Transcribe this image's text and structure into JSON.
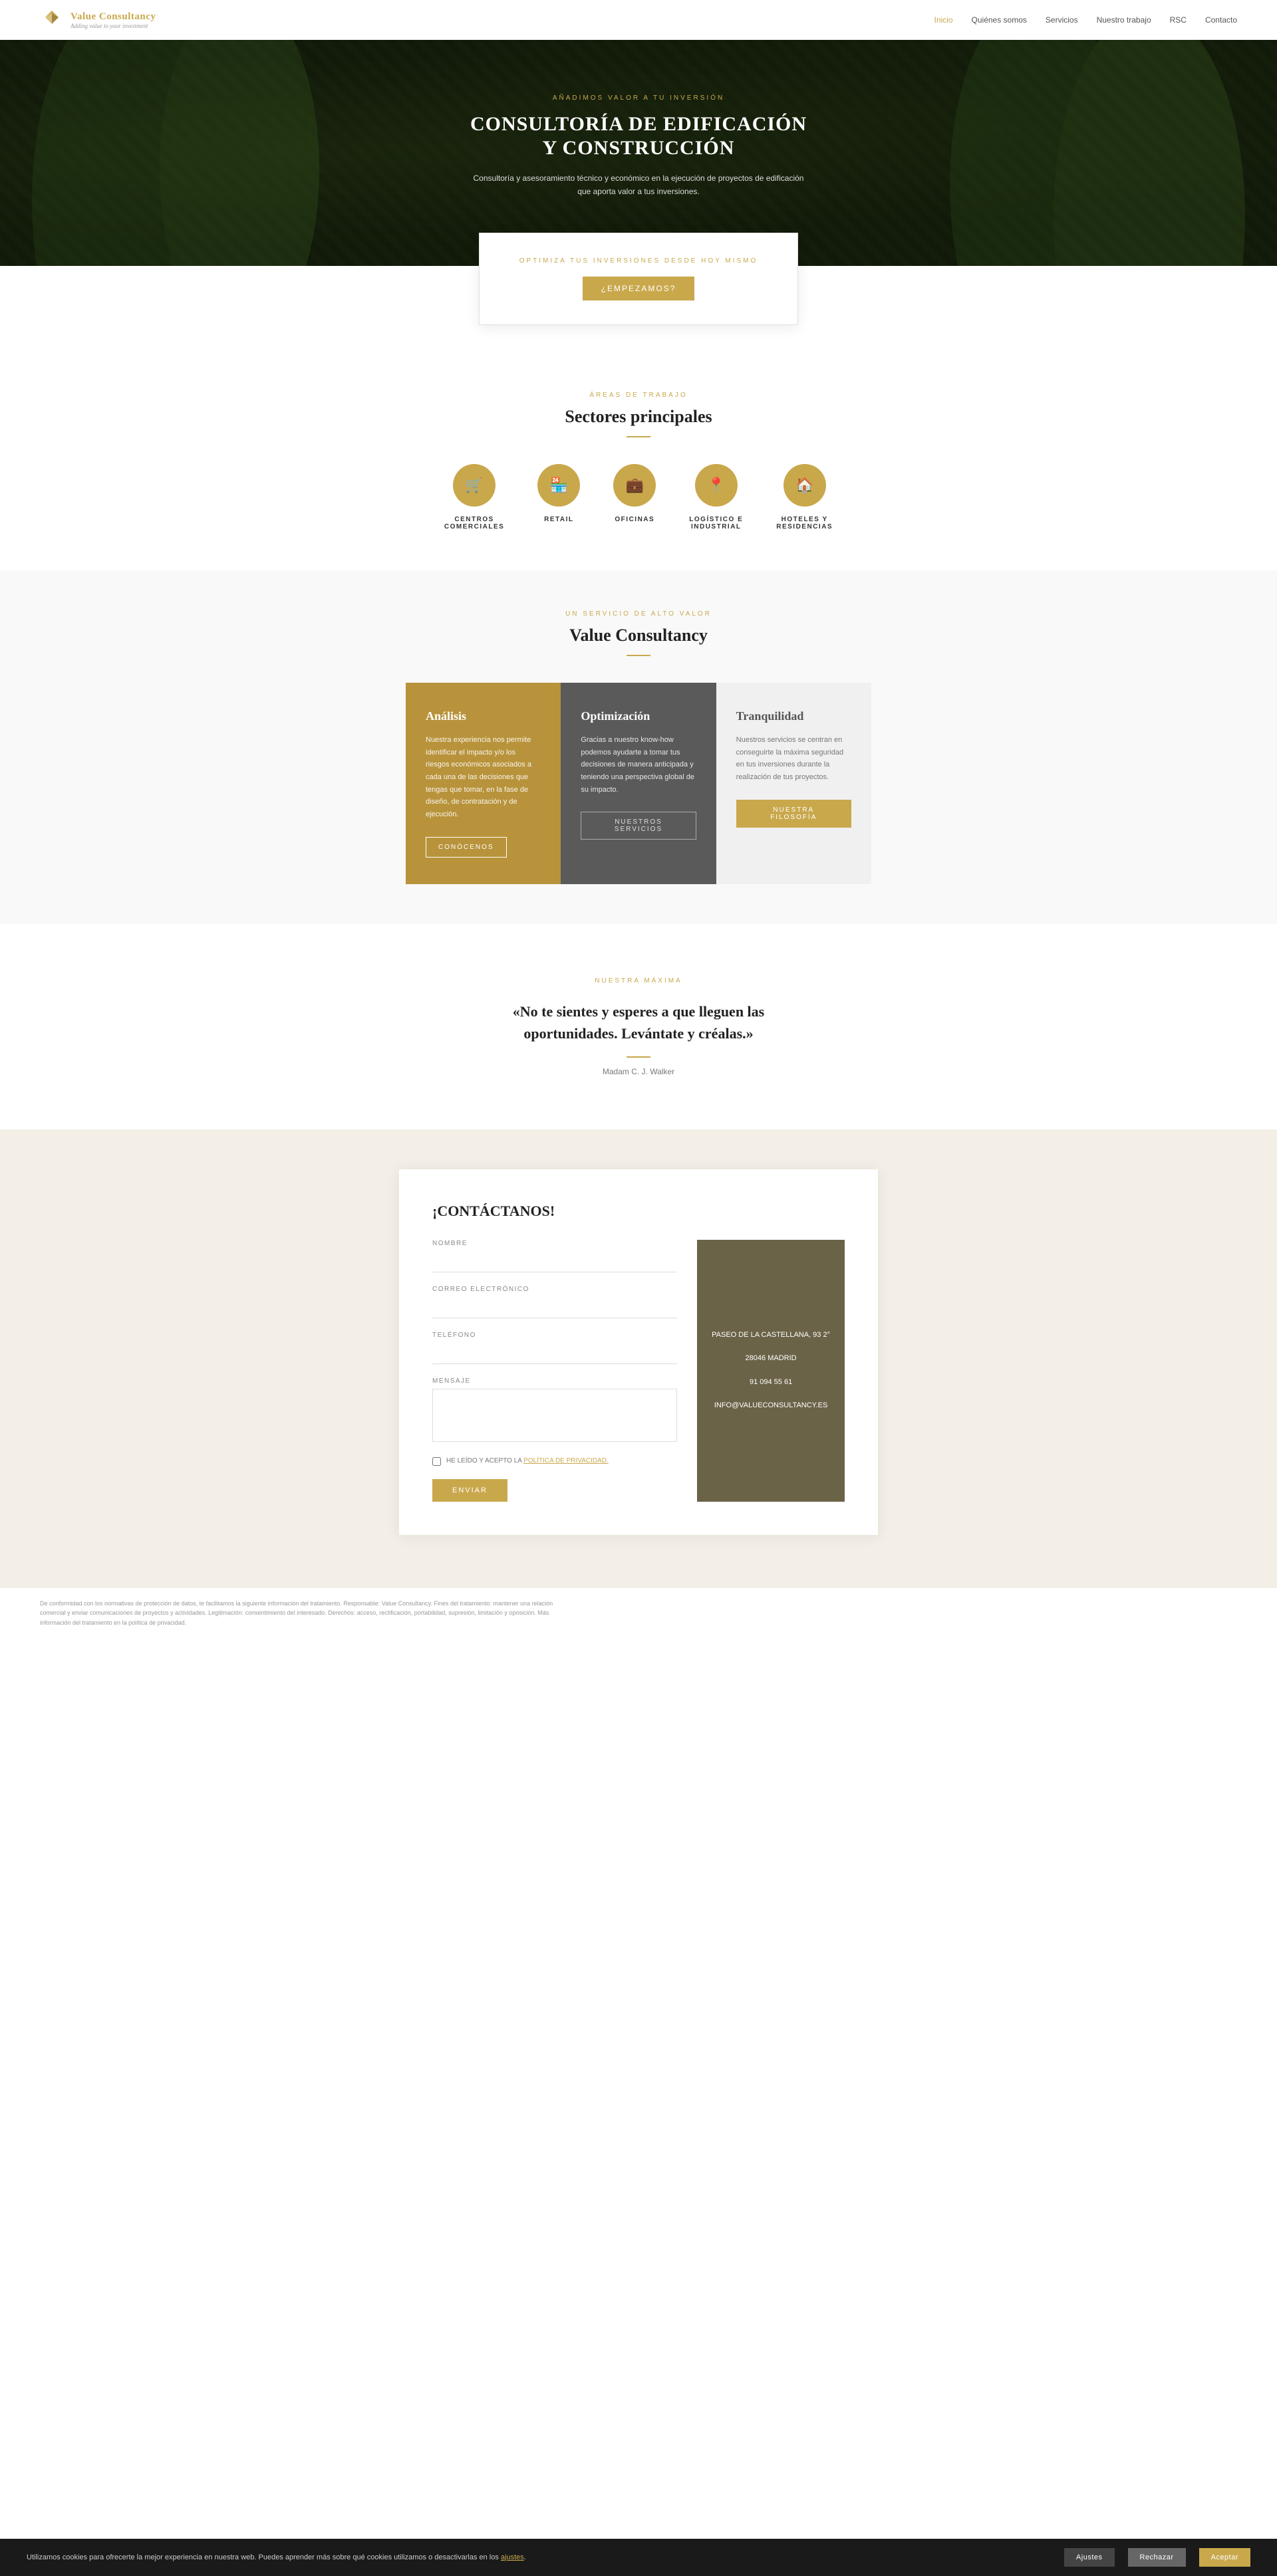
{
  "brand": {
    "name_part1": "Value",
    "name_part2": " Consultancy",
    "tagline": "Adding value to your investment"
  },
  "nav": {
    "links": [
      {
        "label": "Inicio",
        "active": true
      },
      {
        "label": "Quiénes somos",
        "active": false
      },
      {
        "label": "Servicios",
        "active": false
      },
      {
        "label": "Nuestro trabajo",
        "active": false
      },
      {
        "label": "RSC",
        "active": false
      },
      {
        "label": "Contacto",
        "active": false
      }
    ]
  },
  "hero": {
    "sup": "AÑADIMOS VALOR A TU INVERSIÓN",
    "title": "CONSULTORÍA DE EDIFICACIÓN Y CONSTRUCCIÓN",
    "subtitle": "Consultoría y asesoramiento técnico y económico en la ejecución de proyectos de edificación que aporta valor a tus inversiones."
  },
  "cta": {
    "label": "OPTIMIZA TUS INVERSIONES DESDE HOY MISMO",
    "button": "¿EMPEZAMOS?"
  },
  "sectors": {
    "sup": "ÁREAS DE TRABAJO",
    "title": "Sectores principales",
    "items": [
      {
        "label": "CENTROS COMERCIALES",
        "icon": "🛒"
      },
      {
        "label": "RETAIL",
        "icon": "🏪"
      },
      {
        "label": "OFICINAS",
        "icon": "💼"
      },
      {
        "label": "LOGÍSTICO E INDUSTRIAL",
        "icon": "📍"
      },
      {
        "label": "HOTELES Y RESIDENCIAS",
        "icon": "🏠"
      }
    ]
  },
  "value_section": {
    "sup": "UN SERVICIO DE ALTO VALOR",
    "title": "Value Consultancy",
    "cards": [
      {
        "type": "gold",
        "title": "Análisis",
        "text": "Nuestra experiencia nos permite identificar el impacto y/o los riesgos económicos asociados a cada una de las decisiones que tengas que tomar, en la fase de diseño, de contratación y de ejecución.",
        "button": "CONÓCENOS",
        "btn_type": "outlined-white"
      },
      {
        "type": "dark",
        "title": "Optimización",
        "text": "Gracias a nuestro know-how podemos ayudarte a tomar tus decisiones de manera anticipada y teniendo una perspectiva global de su impacto.",
        "button": "NUESTROS SERVICIOS",
        "btn_type": "outlined-dark"
      },
      {
        "type": "light",
        "title": "Tranquilidad",
        "text": "Nuestros servicios se centran en conseguirte la máxima seguridad en tus inversiones durante la realización de tus proyectos.",
        "button": "NUESTRA FILOSOFÍA",
        "btn_type": "solid-gold"
      }
    ]
  },
  "quote": {
    "sup": "NUESTRA MÁXIMA",
    "text": "«No te sientes y esperes a que lleguen las oportunidades. Levántate y créalas.»",
    "author": "Madam C. J. Walker"
  },
  "contact": {
    "title": "¡CONTÁCTANOS!",
    "fields": {
      "name_label": "NOMBRE",
      "email_label": "CORREO ELECTRÓNICO",
      "phone_label": "TELÉFONO",
      "message_label": "MENSAJE"
    },
    "privacy_text": "HE LEÍDO Y ACEPTO LA ",
    "privacy_link": "POLÍTICA DE PRIVACIDAD.",
    "submit": "ENVIAR",
    "info": {
      "address": "PASEO DE LA CASTELLANA, 93 2°",
      "city": "28046 MADRID",
      "phone": "91 094 55 61",
      "email": "INFO@VALUECONSULTANCY.ES"
    }
  },
  "legal": {
    "text": "De conformidad con los normativas de protección de datos, te facilitamos la siguiente información del tratamiento. Responsable: Value Consultancy. Fines del tratamiento: mantener una relación comercial y enviar comunicaciones de proyectos y actividades. Legitimación: consentimiento del interesado. Derechos: acceso, rectificación, portabilidad, supresión, limitación y oposición. Más información del tratamiento en la política de privacidad."
  },
  "cookies": {
    "text": "Utilizamos cookies para ofrecerte la mejor experiencia en nuestra web. Puedes aprender más sobre qué cookies utilizamos o desactivarlas en los ",
    "link_text": "ajustes",
    "settings_btn": "Ajustes",
    "reject_btn": "Rechazar",
    "accept_btn": "Aceptar"
  }
}
